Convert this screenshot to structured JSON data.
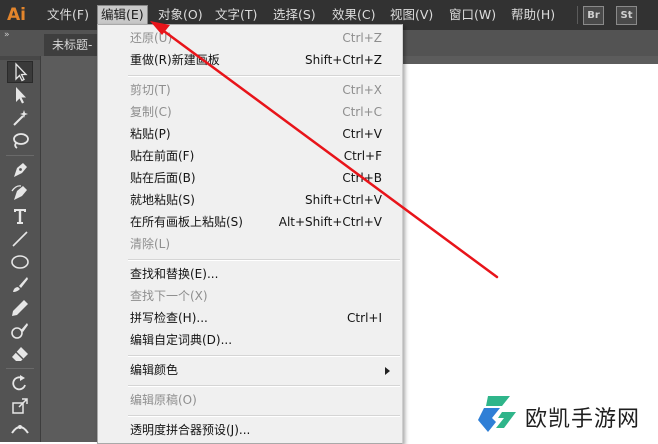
{
  "app": {
    "logo": "Ai"
  },
  "menubar": {
    "items": [
      {
        "label": "文件(F)"
      },
      {
        "label": "编辑(E)"
      },
      {
        "label": "对象(O)"
      },
      {
        "label": "文字(T)"
      },
      {
        "label": "选择(S)"
      },
      {
        "label": "效果(C)"
      },
      {
        "label": "视图(V)"
      },
      {
        "label": "窗口(W)"
      },
      {
        "label": "帮助(H)"
      }
    ],
    "active_item": "编辑(E)",
    "badges": [
      {
        "label": "Br"
      },
      {
        "label": "St"
      }
    ]
  },
  "tabstrip": {
    "collapse_glyph": "»",
    "document_tab": "未标题-"
  },
  "tools": [
    {
      "icon": "selection-tool-icon"
    },
    {
      "icon": "direct-selection-tool-icon"
    },
    {
      "icon": "magic-wand-tool-icon"
    },
    {
      "icon": "lasso-tool-icon"
    },
    {
      "icon": "pen-tool-icon"
    },
    {
      "icon": "curvature-tool-icon"
    },
    {
      "icon": "type-tool-icon"
    },
    {
      "icon": "line-segment-tool-icon"
    },
    {
      "icon": "ellipse-tool-icon"
    },
    {
      "icon": "paintbrush-tool-icon"
    },
    {
      "icon": "pencil-tool-icon"
    },
    {
      "icon": "blob-brush-tool-icon"
    },
    {
      "icon": "eraser-tool-icon"
    },
    {
      "icon": "rotate-tool-icon"
    },
    {
      "icon": "scale-tool-icon"
    },
    {
      "icon": "width-tool-icon"
    },
    {
      "icon": "free-transform-tool-icon"
    }
  ],
  "edit_menu": {
    "groups": [
      [
        {
          "label": "还原(U)",
          "shortcut": "Ctrl+Z",
          "disabled": true
        },
        {
          "label": "重做(R)新建画板",
          "shortcut": "Shift+Ctrl+Z",
          "disabled": false
        }
      ],
      [
        {
          "label": "剪切(T)",
          "shortcut": "Ctrl+X",
          "disabled": true
        },
        {
          "label": "复制(C)",
          "shortcut": "Ctrl+C",
          "disabled": true
        },
        {
          "label": "粘贴(P)",
          "shortcut": "Ctrl+V",
          "disabled": false
        },
        {
          "label": "贴在前面(F)",
          "shortcut": "Ctrl+F",
          "disabled": false
        },
        {
          "label": "贴在后面(B)",
          "shortcut": "Ctrl+B",
          "disabled": false
        },
        {
          "label": "就地粘贴(S)",
          "shortcut": "Shift+Ctrl+V",
          "disabled": false
        },
        {
          "label": "在所有画板上粘贴(S)",
          "shortcut": "Alt+Shift+Ctrl+V",
          "disabled": false
        },
        {
          "label": "清除(L)",
          "shortcut": "",
          "disabled": true
        }
      ],
      [
        {
          "label": "查找和替换(E)...",
          "shortcut": "",
          "disabled": false
        },
        {
          "label": "查找下一个(X)",
          "shortcut": "",
          "disabled": true
        },
        {
          "label": "拼写检查(H)...",
          "shortcut": "Ctrl+I",
          "disabled": false
        },
        {
          "label": "编辑自定词典(D)...",
          "shortcut": "",
          "disabled": false
        }
      ],
      [
        {
          "label": "编辑颜色",
          "shortcut": "",
          "disabled": false,
          "submenu": true
        }
      ],
      [
        {
          "label": "编辑原稿(O)",
          "shortcut": "",
          "disabled": true
        }
      ],
      [
        {
          "label": "透明度拼合器预设(J)...",
          "shortcut": "",
          "disabled": false
        }
      ]
    ]
  },
  "watermark": {
    "text": "欧凯手游网"
  },
  "colors": {
    "menubar_bg": "#323232",
    "panel_bg": "#535353",
    "menu_bg": "#f0f0f0",
    "arrow": "#e8141a",
    "logo_orange": "#e3852c",
    "watermark_green": "#2fb58a",
    "watermark_blue": "#2f7fd6"
  }
}
